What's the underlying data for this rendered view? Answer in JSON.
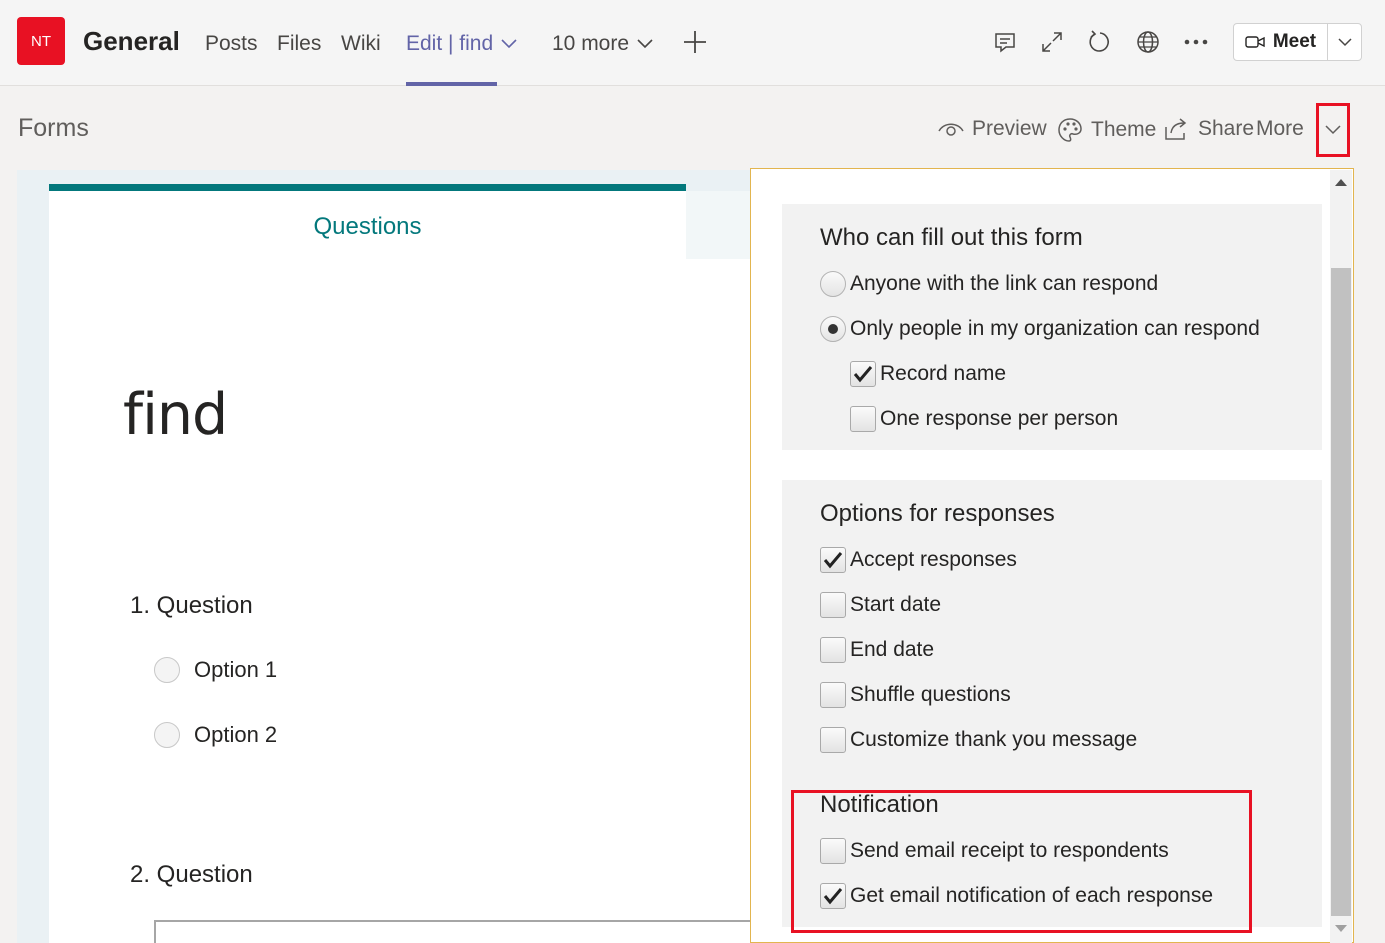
{
  "header": {
    "avatar_initials": "NT",
    "team_name": "General",
    "tabs": [
      {
        "label": "Posts"
      },
      {
        "label": "Files"
      },
      {
        "label": "Wiki"
      },
      {
        "label": "Edit | find",
        "active": true
      },
      {
        "label": "10 more"
      }
    ],
    "actions": [
      "conversation-icon",
      "expand-icon",
      "refresh-icon",
      "globe-icon",
      "more-icon"
    ],
    "meet_label": "Meet",
    "accent_color": "#6264a7",
    "avatar_color": "#e81123"
  },
  "forms_header": {
    "title": "Forms",
    "preview_label": "Preview",
    "theme_label": "Theme",
    "share_label": "Share",
    "more_label": "More"
  },
  "form": {
    "tab_label": "Questions",
    "title": "find",
    "questions": [
      {
        "label": "1. Question",
        "options": [
          "Option 1",
          "Option 2"
        ]
      },
      {
        "label": "2. Question"
      }
    ],
    "theme_color": "#03787c"
  },
  "settings": {
    "who": {
      "title": "Who can fill out this form",
      "options": [
        {
          "label": "Anyone with the link can respond",
          "selected": false
        },
        {
          "label": "Only people in my organization can respond",
          "selected": true
        }
      ],
      "sub_options": [
        {
          "label": "Record name",
          "checked": true
        },
        {
          "label": "One response per person",
          "checked": false
        }
      ]
    },
    "responses": {
      "title": "Options for responses",
      "options": [
        {
          "label": "Accept responses",
          "checked": true
        },
        {
          "label": "Start date",
          "checked": false
        },
        {
          "label": "End date",
          "checked": false
        },
        {
          "label": "Shuffle questions",
          "checked": false
        },
        {
          "label": "Customize thank you message",
          "checked": false
        }
      ]
    },
    "notification": {
      "title": "Notification",
      "options": [
        {
          "label": "Send email receipt to respondents",
          "checked": false
        },
        {
          "label": "Get email notification of each response",
          "checked": true
        }
      ]
    },
    "highlight_color": "#e81123"
  }
}
